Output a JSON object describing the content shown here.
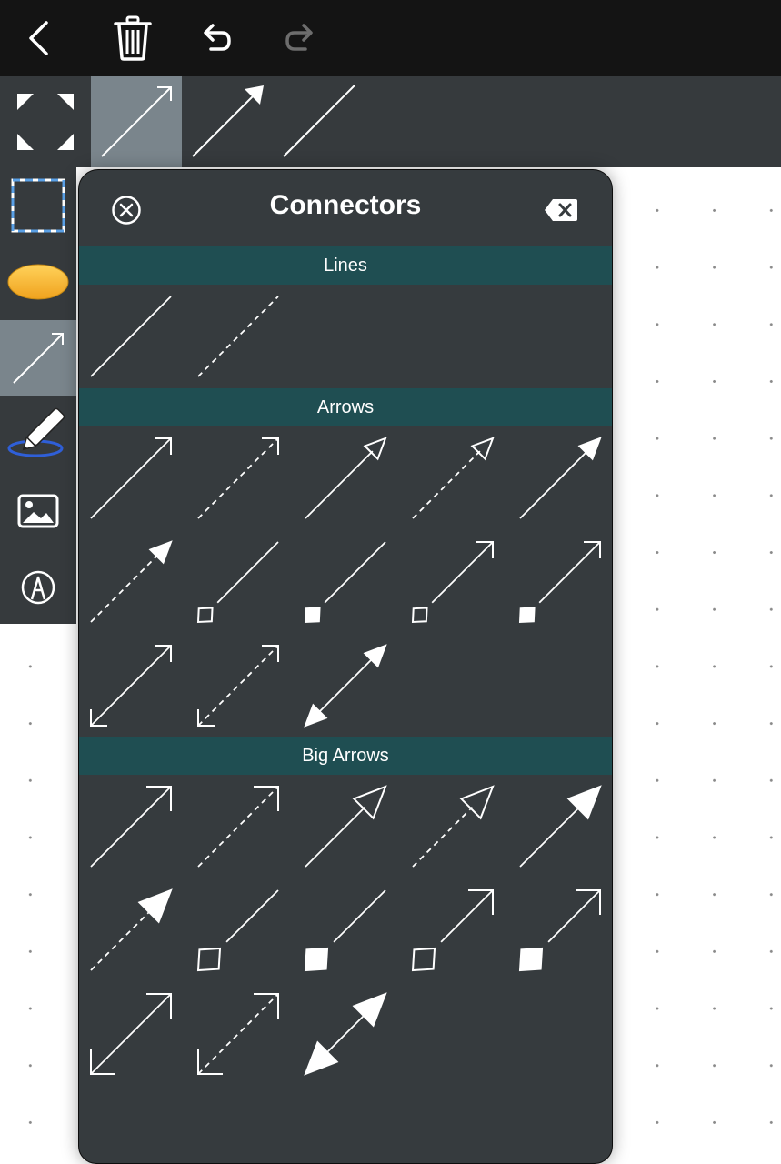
{
  "toolbar": {
    "icons": [
      "back-icon",
      "trash-icon",
      "undo-icon",
      "redo-icon"
    ],
    "redo_enabled": false
  },
  "style_strip": {
    "icons": [
      "fit-screen-icon",
      "connector-open-arrow-icon",
      "connector-filled-arrow-icon",
      "connector-line-icon"
    ],
    "selected_index": 1
  },
  "sidebar": {
    "tools": [
      "select-rectangle-icon",
      "ellipse-shape-icon",
      "connector-tool-icon",
      "freehand-pen-icon",
      "image-icon",
      "text-style-icon"
    ],
    "selected_tool": "connector-tool-icon"
  },
  "panel": {
    "title": "Connectors",
    "close_icon": "close-circle-icon",
    "delete_icon": "delete-backspace-icon",
    "sections": [
      {
        "label": "Lines",
        "items": [
          {
            "line": "solid",
            "start": "none",
            "end": "none"
          },
          {
            "line": "dashed",
            "start": "none",
            "end": "none"
          }
        ]
      },
      {
        "label": "Arrows",
        "size": "small",
        "items": [
          {
            "line": "solid",
            "start": "none",
            "end": "open-arrow"
          },
          {
            "line": "dashed",
            "start": "none",
            "end": "open-arrow"
          },
          {
            "line": "solid",
            "start": "none",
            "end": "hollow-triangle"
          },
          {
            "line": "dashed",
            "start": "none",
            "end": "hollow-triangle"
          },
          {
            "line": "solid",
            "start": "none",
            "end": "filled-triangle"
          },
          {
            "line": "dashed",
            "start": "none",
            "end": "filled-triangle"
          },
          {
            "line": "solid",
            "start": "hollow-diamond",
            "end": "none"
          },
          {
            "line": "solid",
            "start": "filled-diamond",
            "end": "none"
          },
          {
            "line": "solid",
            "start": "hollow-diamond",
            "end": "open-arrow"
          },
          {
            "line": "solid",
            "start": "filled-diamond",
            "end": "open-arrow"
          },
          {
            "line": "solid",
            "start": "open-arrow",
            "end": "open-arrow"
          },
          {
            "line": "dashed",
            "start": "open-arrow",
            "end": "open-arrow"
          },
          {
            "line": "solid",
            "start": "filled-triangle",
            "end": "filled-triangle"
          }
        ]
      },
      {
        "label": "Big Arrows",
        "size": "big",
        "items": [
          {
            "line": "solid",
            "start": "none",
            "end": "open-arrow"
          },
          {
            "line": "dashed",
            "start": "none",
            "end": "open-arrow"
          },
          {
            "line": "solid",
            "start": "none",
            "end": "hollow-triangle"
          },
          {
            "line": "dashed",
            "start": "none",
            "end": "hollow-triangle"
          },
          {
            "line": "solid",
            "start": "none",
            "end": "filled-triangle"
          },
          {
            "line": "dashed",
            "start": "none",
            "end": "filled-triangle"
          },
          {
            "line": "solid",
            "start": "hollow-diamond",
            "end": "none"
          },
          {
            "line": "solid",
            "start": "filled-diamond",
            "end": "none"
          },
          {
            "line": "solid",
            "start": "hollow-diamond",
            "end": "open-arrow"
          },
          {
            "line": "solid",
            "start": "filled-diamond",
            "end": "open-arrow"
          },
          {
            "line": "solid",
            "start": "open-arrow",
            "end": "open-arrow"
          },
          {
            "line": "dashed",
            "start": "open-arrow",
            "end": "open-arrow"
          },
          {
            "line": "solid",
            "start": "filled-triangle",
            "end": "filled-triangle"
          }
        ]
      }
    ]
  },
  "colors": {
    "toolbar_bg": "#141414",
    "strip_bg": "#363a3d",
    "selected_bg": "#7a858c",
    "panel_bg": "#363b3e",
    "section_bg": "#1f4e52",
    "icon": "#ffffff",
    "disabled_icon": "#6d6d6d",
    "ellipse_fill": "#f7b731",
    "selection_dash": "#5aa0e6",
    "pen_ring": "#2f5fd8"
  }
}
